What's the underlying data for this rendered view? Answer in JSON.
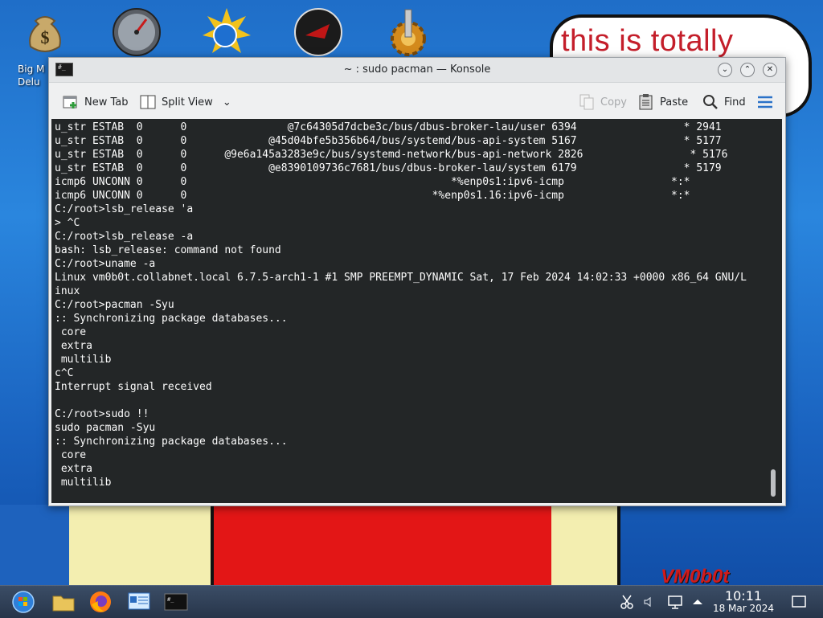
{
  "desktop": {
    "speech_text": "this is totally",
    "logo_text": "VM0b0t",
    "icons": [
      {
        "name": "big-money-icon",
        "label": "Big M"
      },
      {
        "name": "speedometer-icon",
        "label": ""
      },
      {
        "name": "sun-globe-icon",
        "label": ""
      },
      {
        "name": "red-eye-icon",
        "label": ""
      },
      {
        "name": "gear-pipe-icon",
        "label": ""
      }
    ],
    "icon_label_line2": "Delu"
  },
  "window": {
    "title": "~ : sudo pacman — Konsole",
    "title_icon_text": "#_",
    "toolbar": {
      "new_tab": "New Tab",
      "split_view": "Split View",
      "copy": "Copy",
      "paste": "Paste",
      "find": "Find"
    }
  },
  "terminal": {
    "lines": [
      "u_str ESTAB  0      0                @7c64305d7dcbe3c/bus/dbus-broker-lau/user 6394                 * 2941",
      "u_str ESTAB  0      0             @45d04bfe5b356b64/bus/systemd/bus-api-system 5167                 * 5177",
      "u_str ESTAB  0      0      @9e6a145a3283e9c/bus/systemd-network/bus-api-network 2826                 * 5176",
      "u_str ESTAB  0      0             @e8390109736c7681/bus/dbus-broker-lau/system 6179                 * 5179",
      "icmp6 UNCONN 0      0                                          *%enp0s1:ipv6-icmp                 *:*",
      "icmp6 UNCONN 0      0                                       *%enp0s1.16:ipv6-icmp                 *:*",
      "C:/root>lsb_release 'a",
      "> ^C",
      "C:/root>lsb_release -a",
      "bash: lsb_release: command not found",
      "C:/root>uname -a",
      "Linux vm0b0t.collabnet.local 6.7.5-arch1-1 #1 SMP PREEMPT_DYNAMIC Sat, 17 Feb 2024 14:02:33 +0000 x86_64 GNU/L",
      "inux",
      "C:/root>pacman -Syu",
      ":: Synchronizing package databases...",
      " core",
      " extra",
      " multilib",
      "c^C",
      "Interrupt signal received",
      "",
      "C:/root>sudo !!",
      "sudo pacman -Syu",
      ":: Synchronizing package databases...",
      " core",
      " extra",
      " multilib"
    ]
  },
  "taskbar": {
    "time": "10:11",
    "date": "18 Mar 2024"
  }
}
